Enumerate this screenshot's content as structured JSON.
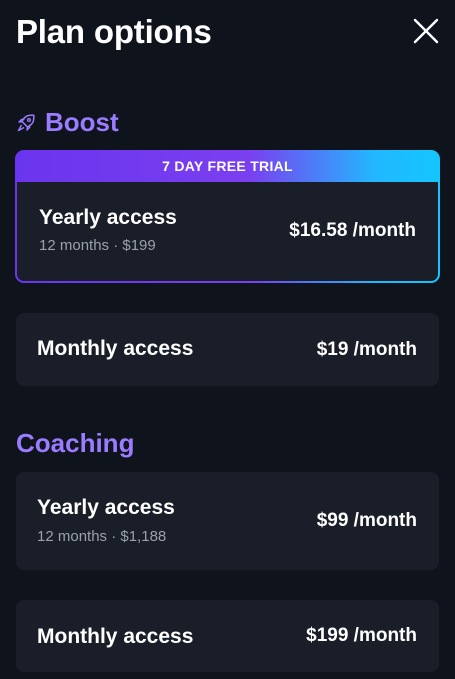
{
  "header": {
    "title": "Plan options",
    "close_icon": "close-icon"
  },
  "boost": {
    "title": "Boost",
    "icon": "rocket-icon",
    "accent": "#9b7bff",
    "featured": {
      "banner": "7 DAY FREE TRIAL",
      "name": "Yearly access",
      "sub": "12 months · $199",
      "price": "$16.58 /month"
    },
    "monthly": {
      "name": "Monthly access",
      "price": "$19 /month"
    }
  },
  "coaching": {
    "title": "Coaching",
    "yearly": {
      "name": "Yearly access",
      "sub": "12 months · $1,188",
      "price": "$99 /month"
    },
    "monthly": {
      "name": "Monthly access",
      "price": "$199 /month"
    }
  },
  "colors": {
    "background": "#0e131c",
    "card": "#191e29",
    "gradient_start": "#6a35ee",
    "gradient_end": "#14c5ff"
  }
}
